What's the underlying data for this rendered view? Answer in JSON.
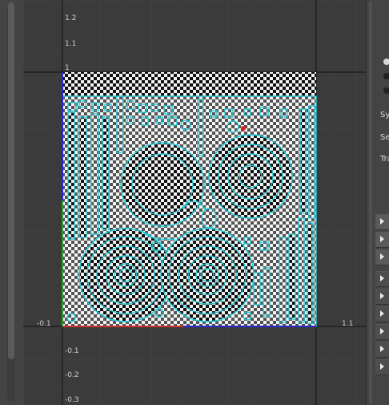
{
  "viewport": {
    "u_ticks": [
      "-0.1",
      "1.1"
    ],
    "v_ticks": [
      "1.2",
      "1.1",
      "1",
      "-0.1",
      "-0.2",
      "-0.3"
    ]
  },
  "right_panel": {
    "labels": [
      "Sy",
      "Se",
      "Tra"
    ]
  },
  "colors": {
    "uv_wire": "#27c9d6",
    "u_axis": "#d23030",
    "v_axis": "#2a2ad0",
    "selected_vertex": "#e02020"
  }
}
